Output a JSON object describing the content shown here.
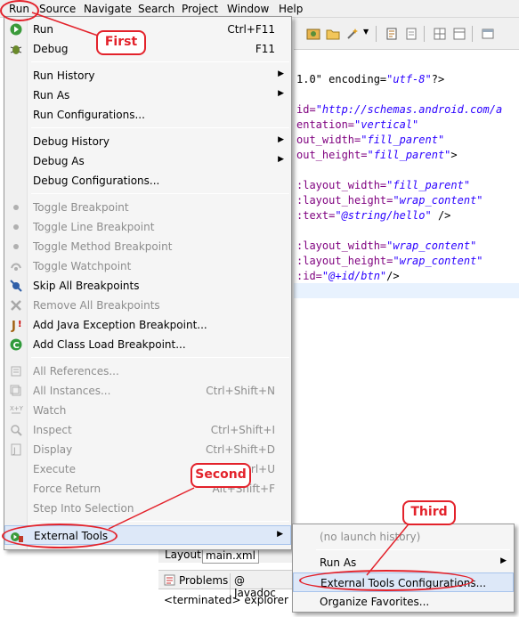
{
  "menubar": {
    "items": [
      "Run",
      "Source",
      "Navigate",
      "Search",
      "Project",
      "Window",
      "Help"
    ]
  },
  "editor": {
    "lines": [
      {
        "a": "1.0\" encoding=",
        "b": "\"utf-8\"",
        "c": "?>"
      },
      {
        "a": "id=",
        "b": "\"http://schemas.android.com/a",
        "c": ""
      },
      {
        "a": "entation=",
        "b": "\"vertical\"",
        "c": ""
      },
      {
        "a": "out_width=",
        "b": "\"fill_parent\"",
        "c": ""
      },
      {
        "a": "out_height=",
        "b": "\"fill_parent\"",
        "c": ">"
      },
      {
        "a": ":layout_width=",
        "b": "\"fill_parent\"",
        "c": ""
      },
      {
        "a": ":layout_height=",
        "b": "\"wrap_content\"",
        "c": ""
      },
      {
        "a": ":text=",
        "b": "\"@string/hello\"",
        "c": " />"
      },
      {
        "a": ":layout_width=",
        "b": "\"wrap_content\"",
        "c": ""
      },
      {
        "a": ":layout_height=",
        "b": "\"wrap_content\"",
        "c": ""
      },
      {
        "a": ":id=",
        "b": "\"@+id/btn\"",
        "c": "/>"
      }
    ]
  },
  "run_menu": {
    "run": {
      "label": "Run",
      "accel": "Ctrl+F11"
    },
    "debug": {
      "label": "Debug",
      "accel": "F11"
    },
    "run_history": "Run History",
    "run_as": "Run As",
    "run_configurations": "Run Configurations...",
    "debug_history": "Debug History",
    "debug_as": "Debug As",
    "debug_configurations": "Debug Configurations...",
    "toggle_breakpoint": "Toggle Breakpoint",
    "toggle_line_breakpoint": "Toggle Line Breakpoint",
    "toggle_method_breakpoint": "Toggle Method Breakpoint",
    "toggle_watchpoint": "Toggle Watchpoint",
    "skip_all_breakpoints": "Skip All Breakpoints",
    "remove_all_breakpoints": "Remove All Breakpoints",
    "add_java_exception_breakpoint": "Add Java Exception Breakpoint...",
    "add_class_load_breakpoint": "Add Class Load Breakpoint...",
    "all_references": "All References...",
    "all_instances": {
      "label": "All Instances...",
      "accel": "Ctrl+Shift+N"
    },
    "watch": "Watch",
    "inspect": {
      "label": "Inspect",
      "accel": "Ctrl+Shift+I"
    },
    "display": {
      "label": "Display",
      "accel": "Ctrl+Shift+D"
    },
    "execute": {
      "label": "Execute",
      "accel": "Ctrl+U"
    },
    "force_return": {
      "label": "Force Return",
      "accel": "Alt+Shift+F"
    },
    "step_into_selection": "Step Into Selection",
    "external_tools": "External Tools"
  },
  "external_tools_submenu": {
    "no_history": "(no launch history)",
    "run_as": "Run As",
    "configurations": "External Tools Configurations...",
    "organize_favorites": "Organize Favorites..."
  },
  "bottom": {
    "tab_layout": "Layout",
    "tab_main_xml": "main.xml",
    "tab_problems": "Problems",
    "tab_javadoc": "Javadoc",
    "console_text": "<terminated> explorer [Pro"
  },
  "annotations": {
    "first": "First",
    "second": "Second",
    "third": "Third",
    "color": "#e3222b"
  }
}
